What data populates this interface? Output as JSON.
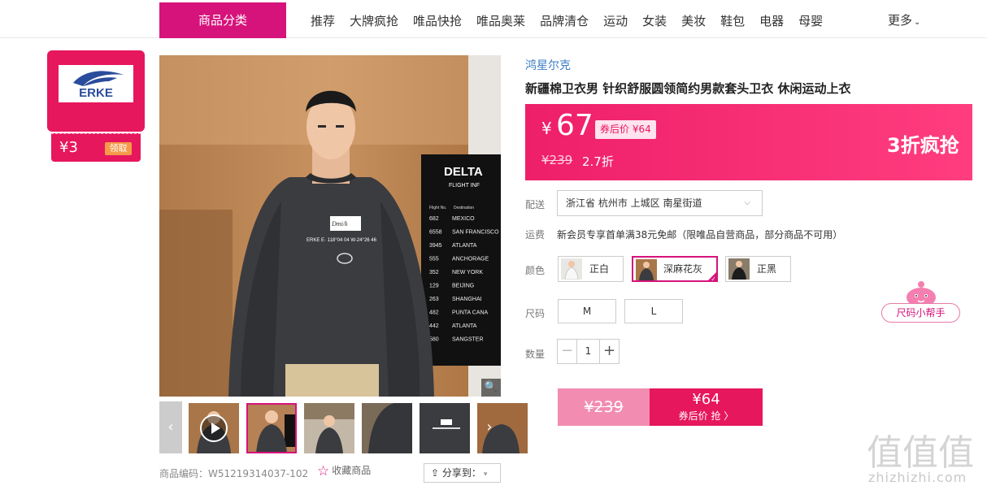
{
  "nav": {
    "category_button": "商品分类",
    "items": [
      "推荐",
      "大牌疯抢",
      "唯品快抢",
      "唯品奥莱",
      "品牌清仓",
      "运动",
      "女装",
      "美妆",
      "鞋包",
      "电器",
      "母婴"
    ],
    "more": "更多"
  },
  "coupon": {
    "brand_logo_text": "ERKE",
    "amount": "¥3",
    "claim_label": "领取"
  },
  "product": {
    "brand": "鸿星尔克",
    "title": "新疆棉卫衣男 针织舒服圆领简约男款套头卫衣 休闲运动上衣",
    "sku_code": "商品编码：W51219314037-102",
    "favorite_label": "收藏商品",
    "share_label": "分享到："
  },
  "price": {
    "currency": "¥",
    "value": "67",
    "after_coupon": "券后价 ¥64",
    "original": "¥239",
    "discount": "2.7折",
    "flash_tag": "3折疯抢"
  },
  "shipping": {
    "label": "配送",
    "address": "浙江省 杭州市 上城区 南星街道",
    "fee_label": "运费",
    "fee_text": "新会员专享首单满38元免邮（限唯品自营商品，部分商品不可用）"
  },
  "colors": {
    "label": "颜色",
    "options": [
      "正白",
      "深麻花灰",
      "正黑"
    ],
    "selected_index": 1
  },
  "sizes": {
    "label": "尺码",
    "options": [
      "M",
      "L"
    ],
    "helper": "尺码小帮手"
  },
  "quantity": {
    "label": "数量",
    "value": "1",
    "minus": "−",
    "plus": "+"
  },
  "buy": {
    "original": "¥239",
    "price": "¥64",
    "sub": "券后价 抢 〉"
  },
  "gallery": {
    "thumb_count": 6,
    "active_index": 1,
    "shirt_text_1": "ERKE E· 118°04 04 W-24°26 46",
    "sign_title": "DELTA",
    "sign_subtitle": "FLIGHT INF",
    "board_header": [
      "Flight No.",
      "Destination"
    ],
    "board_rows": [
      [
        "682",
        "MEXICO"
      ],
      [
        "6558",
        "SAN FRANCISCO"
      ],
      [
        "3945",
        "ATLANTA"
      ],
      [
        "555",
        "ANCHORAGE"
      ],
      [
        "352",
        "NEW YORK"
      ],
      [
        "129",
        "BEIJING"
      ],
      [
        "263",
        "SHANGHAI"
      ],
      [
        "482",
        "PUNTA CANA"
      ],
      [
        "442",
        "ATLANTA"
      ],
      [
        "580",
        "SANGSTER"
      ]
    ]
  },
  "watermark": {
    "chars": "值值值",
    "url": "zhizhizhi.com"
  },
  "colors_theme": {
    "accent": "#d6137b",
    "price_bg": "#ee1f69",
    "link": "#3b7ec5"
  }
}
